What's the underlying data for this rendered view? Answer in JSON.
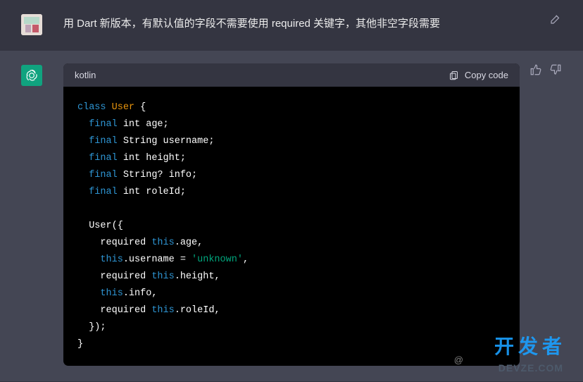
{
  "user": {
    "message": "用 Dart 新版本，有默认值的字段不需要使用 required  关键字，其他非空字段需要"
  },
  "assistant": {
    "code_lang": "kotlin",
    "copy_label": "Copy code",
    "code_tokens": [
      [
        {
          "c": "tk-kw",
          "t": "class"
        },
        {
          "t": " "
        },
        {
          "c": "tk-cls",
          "t": "User"
        },
        {
          "t": " {"
        }
      ],
      [
        {
          "t": "  "
        },
        {
          "c": "tk-kw",
          "t": "final"
        },
        {
          "t": " int age;"
        }
      ],
      [
        {
          "t": "  "
        },
        {
          "c": "tk-kw",
          "t": "final"
        },
        {
          "t": " String username;"
        }
      ],
      [
        {
          "t": "  "
        },
        {
          "c": "tk-kw",
          "t": "final"
        },
        {
          "t": " int height;"
        }
      ],
      [
        {
          "t": "  "
        },
        {
          "c": "tk-kw",
          "t": "final"
        },
        {
          "t": " String? info;"
        }
      ],
      [
        {
          "t": "  "
        },
        {
          "c": "tk-kw",
          "t": "final"
        },
        {
          "t": " int roleId;"
        }
      ],
      [],
      [
        {
          "t": "  User({"
        }
      ],
      [
        {
          "t": "    required "
        },
        {
          "c": "tk-this",
          "t": "this"
        },
        {
          "t": ".age,"
        }
      ],
      [
        {
          "t": "    "
        },
        {
          "c": "tk-this",
          "t": "this"
        },
        {
          "t": ".username = "
        },
        {
          "c": "tk-str",
          "t": "'unknown'"
        },
        {
          "t": ","
        }
      ],
      [
        {
          "t": "    required "
        },
        {
          "c": "tk-this",
          "t": "this"
        },
        {
          "t": ".height,"
        }
      ],
      [
        {
          "t": "    "
        },
        {
          "c": "tk-this",
          "t": "this"
        },
        {
          "t": ".info,"
        }
      ],
      [
        {
          "t": "    required "
        },
        {
          "c": "tk-this",
          "t": "this"
        },
        {
          "t": ".roleId,"
        }
      ],
      [
        {
          "t": "  });"
        }
      ],
      [
        {
          "t": "}"
        }
      ]
    ]
  },
  "watermark": {
    "line1": "开发者",
    "line2": "DEVZE.COM",
    "credit": "@"
  }
}
